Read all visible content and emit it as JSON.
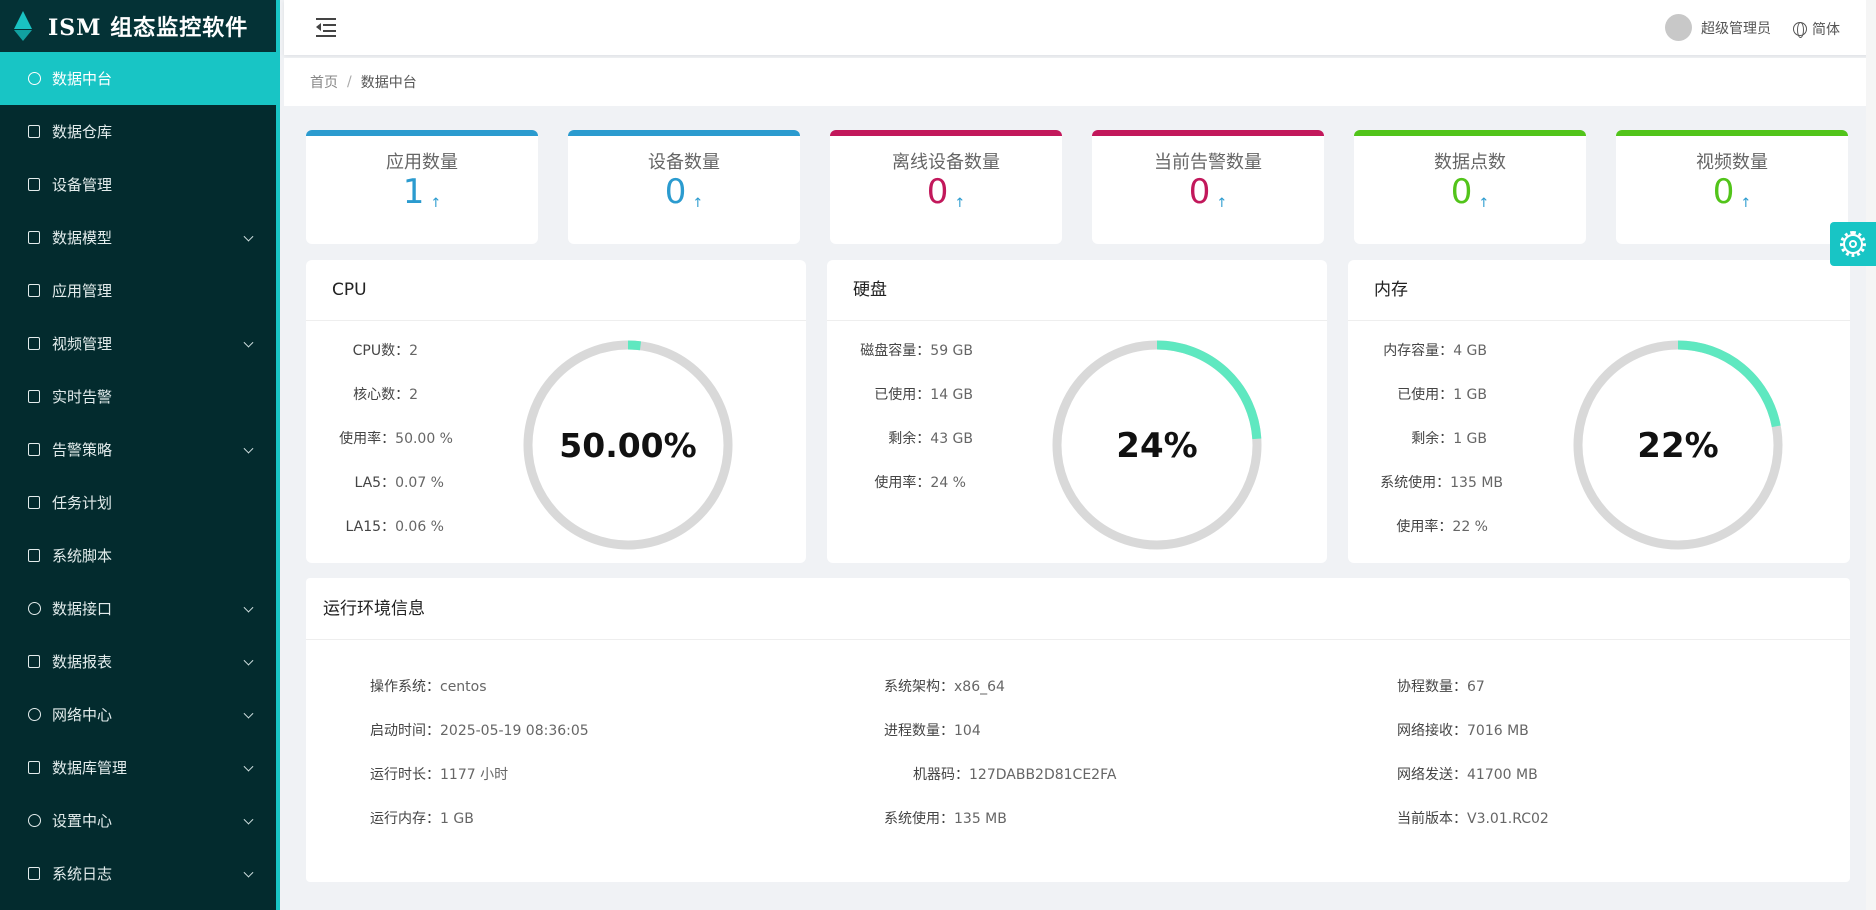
{
  "app": {
    "title": "ISM 组态监控软件"
  },
  "sidebar": {
    "items": [
      {
        "label": "数据中台",
        "icon": "dashboard-icon",
        "active": true,
        "has_children": false
      },
      {
        "label": "数据仓库",
        "icon": "database-icon",
        "active": false,
        "has_children": false
      },
      {
        "label": "设备管理",
        "icon": "device-icon",
        "active": false,
        "has_children": false
      },
      {
        "label": "数据模型",
        "icon": "dropbox-icon",
        "active": false,
        "has_children": true
      },
      {
        "label": "应用管理",
        "icon": "list-icon",
        "active": false,
        "has_children": false
      },
      {
        "label": "视频管理",
        "icon": "video-icon",
        "active": false,
        "has_children": true
      },
      {
        "label": "实时告警",
        "icon": "bell-icon",
        "active": false,
        "has_children": false
      },
      {
        "label": "告警策略",
        "icon": "alarm-icon",
        "active": false,
        "has_children": true
      },
      {
        "label": "任务计划",
        "icon": "calendar-icon",
        "active": false,
        "has_children": false
      },
      {
        "label": "系统脚本",
        "icon": "terminal-icon",
        "active": false,
        "has_children": false
      },
      {
        "label": "数据接口",
        "icon": "api-icon",
        "active": false,
        "has_children": true
      },
      {
        "label": "数据报表",
        "icon": "report-icon",
        "active": false,
        "has_children": true
      },
      {
        "label": "网络中心",
        "icon": "globe-icon",
        "active": false,
        "has_children": true
      },
      {
        "label": "数据库管理",
        "icon": "db-manage-icon",
        "active": false,
        "has_children": true
      },
      {
        "label": "设置中心",
        "icon": "gear-icon",
        "active": false,
        "has_children": true
      },
      {
        "label": "系统日志",
        "icon": "log-icon",
        "active": false,
        "has_children": true
      }
    ]
  },
  "header": {
    "user": "超级管理员",
    "lang": "简体"
  },
  "breadcrumb": {
    "home": "首页",
    "separator": "/",
    "current": "数据中台"
  },
  "stats": [
    {
      "title": "应用数量",
      "value": "1",
      "color": "#2b9bcf"
    },
    {
      "title": "设备数量",
      "value": "0",
      "color": "#2b9bcf"
    },
    {
      "title": "离线设备数量",
      "value": "0",
      "color": "#c2185b"
    },
    {
      "title": "当前告警数量",
      "value": "0",
      "color": "#c2185b"
    },
    {
      "title": "数据点数",
      "value": "0",
      "color": "#52c41a"
    },
    {
      "title": "视频数量",
      "value": "0",
      "color": "#52c41a"
    }
  ],
  "stat_arrow": "↑",
  "cpu": {
    "title": "CPU",
    "rows": [
      {
        "k": "CPU数：",
        "v": "2"
      },
      {
        "k": "核心数：",
        "v": "2"
      },
      {
        "k": "使用率：",
        "v": "50.00 %"
      },
      {
        "k": "LA5：",
        "v": "0.07 %"
      },
      {
        "k": "LA15：",
        "v": "0.06 %"
      }
    ],
    "gauge_label": "50.00%",
    "gauge_fraction": 0.02
  },
  "disk": {
    "title": "硬盘",
    "rows": [
      {
        "k": "磁盘容量：",
        "v": "59 GB"
      },
      {
        "k": "已使用：",
        "v": "14 GB"
      },
      {
        "k": "剩余：",
        "v": "43 GB"
      },
      {
        "k": "使用率：",
        "v": "24 %"
      }
    ],
    "gauge_label": "24%",
    "gauge_fraction": 0.24
  },
  "memory": {
    "title": "内存",
    "rows": [
      {
        "k": "内存容量：",
        "v": "4 GB"
      },
      {
        "k": "已使用：",
        "v": "1 GB"
      },
      {
        "k": "剩余：",
        "v": "1 GB"
      },
      {
        "k": "系统使用：",
        "v": "135 MB"
      },
      {
        "k": "使用率：",
        "v": "22 %"
      }
    ],
    "gauge_label": "22%",
    "gauge_fraction": 0.22
  },
  "gauge_colors": {
    "track": "#d9d9d9",
    "fill": "#5fe8c0"
  },
  "env": {
    "title": "运行环境信息",
    "col1": [
      {
        "k": "操作系统：",
        "v": "centos"
      },
      {
        "k": "启动时间：",
        "v": "2025-05-19 08:36:05"
      },
      {
        "k": "运行时长：",
        "v": "1177 小时"
      },
      {
        "k": "运行内存：",
        "v": "1 GB"
      }
    ],
    "col2": [
      {
        "k": "系统架构：",
        "v": "x86_64"
      },
      {
        "k": "进程数量：",
        "v": "104"
      },
      {
        "k": "机器码：",
        "v": "127DABB2D81CE2FA"
      },
      {
        "k": "系统使用：",
        "v": "135 MB"
      }
    ],
    "col3": [
      {
        "k": "协程数量：",
        "v": "67"
      },
      {
        "k": "网络接收：",
        "v": "7016 MB"
      },
      {
        "k": "网络发送：",
        "v": "41700 MB"
      },
      {
        "k": "当前版本：",
        "v": "V3.01.RC02"
      }
    ]
  }
}
